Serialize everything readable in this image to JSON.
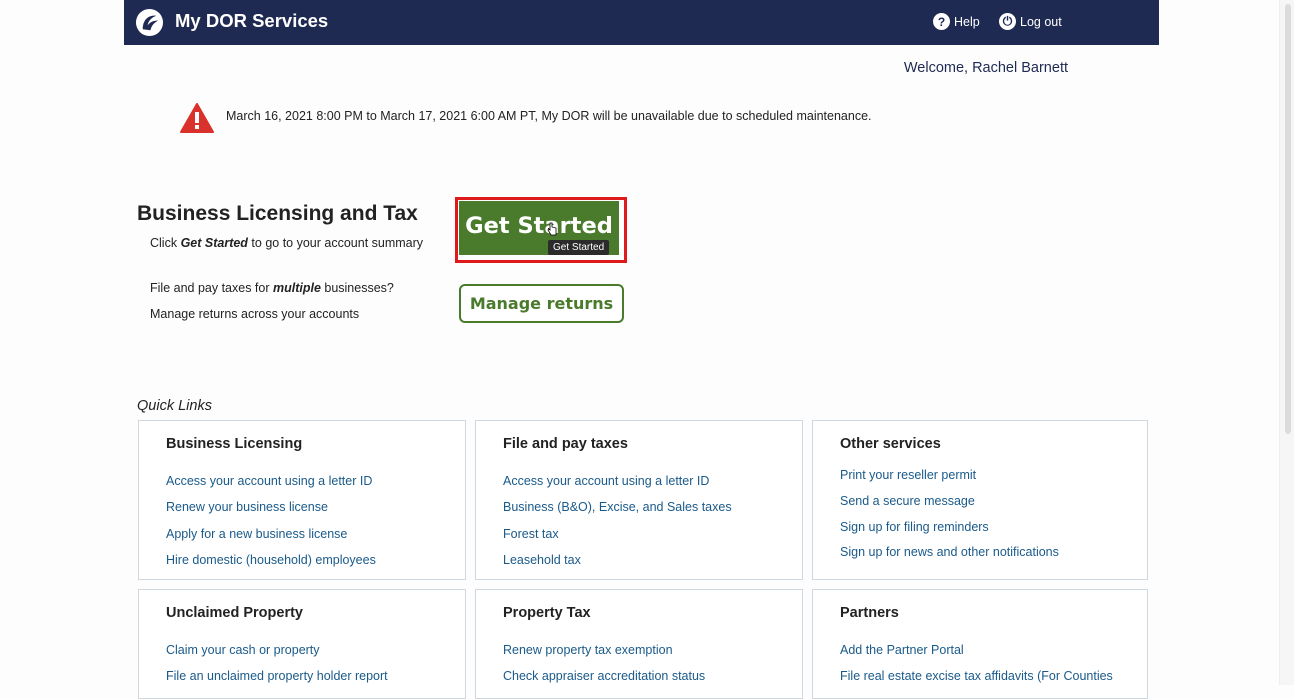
{
  "header": {
    "app_title": "My DOR Services",
    "help_label": "Help",
    "logout_label": "Log out",
    "bg_color": "#1f2a52"
  },
  "welcome": "Welcome, Rachel Barnett",
  "alert": {
    "icon": "warning-icon",
    "text": "March 16, 2021 8:00 PM to March 17, 2021 6:00 AM PT, My DOR will be unavailable due to scheduled maintenance."
  },
  "main": {
    "title": "Business Licensing and Tax",
    "click_prefix": "Click ",
    "click_emph": "Get Started",
    "click_suffix": " to go to your account summary",
    "multi_prefix": "File and pay taxes for ",
    "multi_emph": "multiple",
    "multi_suffix": " businesses?",
    "manage_line": "Manage returns across your accounts",
    "get_started_label": "Get Started",
    "get_started_tooltip": "Get Started",
    "manage_label": "Manage returns",
    "accent_color": "#4a7a2b"
  },
  "quick_links": {
    "label": "Quick Links",
    "cards": [
      {
        "title": "Business Licensing",
        "links": [
          "Access your account using a letter ID",
          "Renew your business license",
          "Apply for a new business license",
          "Hire domestic (household) employees"
        ]
      },
      {
        "title": "File and pay taxes",
        "links": [
          "Access your account using a letter ID",
          "Business (B&O), Excise, and Sales taxes",
          "Forest tax",
          "Leasehold tax"
        ]
      },
      {
        "title": "Other services",
        "links": [
          "Print your reseller permit",
          "Send a secure message",
          "Sign up for filing reminders",
          "Sign up for news and other notifications"
        ]
      },
      {
        "title": "Unclaimed Property",
        "links": [
          "Claim your cash or property",
          "File an unclaimed property holder report"
        ]
      },
      {
        "title": "Property Tax",
        "links": [
          "Renew property tax exemption",
          "Check appraiser accreditation status"
        ]
      },
      {
        "title": "Partners",
        "links": [
          "Add the Partner Portal",
          "File real estate excise tax affidavits (For Counties"
        ]
      }
    ]
  }
}
